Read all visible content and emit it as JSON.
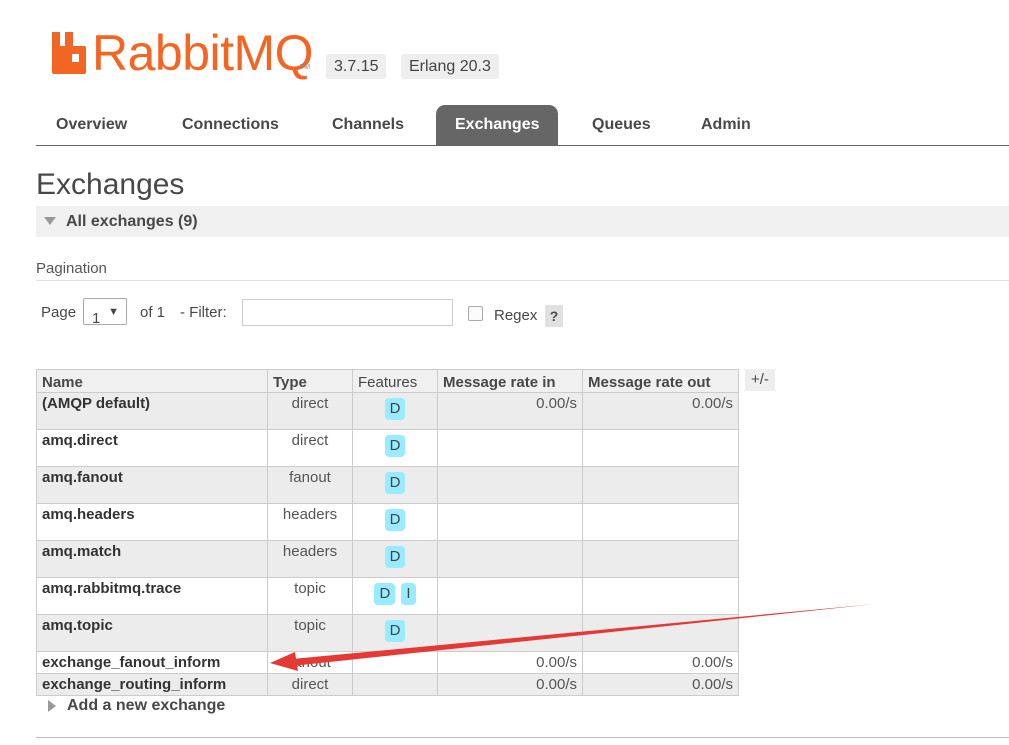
{
  "brand": {
    "logo_text": "RabbitMQ",
    "tm": "TM",
    "version": "3.7.15",
    "erlang": "Erlang 20.3",
    "color": "#f26522"
  },
  "tabs": [
    {
      "label": "Overview"
    },
    {
      "label": "Connections"
    },
    {
      "label": "Channels"
    },
    {
      "label": "Exchanges",
      "active": true
    },
    {
      "label": "Queues"
    },
    {
      "label": "Admin"
    }
  ],
  "page": {
    "title": "Exchanges",
    "section": "All exchanges (9)",
    "add_new": "Add a new exchange"
  },
  "pagination": {
    "heading": "Pagination",
    "page_label": "Page",
    "page_value": "1",
    "of_label": "of 1",
    "filter_label": "- Filter:",
    "filter_value": "",
    "regex_label": "Regex",
    "help": "?"
  },
  "table": {
    "headers": [
      "Name",
      "Type",
      "Features",
      "Message rate in",
      "Message rate out"
    ],
    "toggle_label": "+/-",
    "rows": [
      {
        "name": "(AMQP default)",
        "type": "direct",
        "features": [
          "D"
        ],
        "rate_in": "0.00/s",
        "rate_out": "0.00/s"
      },
      {
        "name": "amq.direct",
        "type": "direct",
        "features": [
          "D"
        ],
        "rate_in": "",
        "rate_out": ""
      },
      {
        "name": "amq.fanout",
        "type": "fanout",
        "features": [
          "D"
        ],
        "rate_in": "",
        "rate_out": ""
      },
      {
        "name": "amq.headers",
        "type": "headers",
        "features": [
          "D"
        ],
        "rate_in": "",
        "rate_out": ""
      },
      {
        "name": "amq.match",
        "type": "headers",
        "features": [
          "D"
        ],
        "rate_in": "",
        "rate_out": ""
      },
      {
        "name": "amq.rabbitmq.trace",
        "type": "topic",
        "features": [
          "D",
          "I"
        ],
        "rate_in": "",
        "rate_out": ""
      },
      {
        "name": "amq.topic",
        "type": "topic",
        "features": [
          "D"
        ],
        "rate_in": "",
        "rate_out": ""
      },
      {
        "name": "exchange_fanout_inform",
        "type": "fanout",
        "features": [],
        "rate_in": "0.00/s",
        "rate_out": "0.00/s"
      },
      {
        "name": "exchange_routing_inform",
        "type": "direct",
        "features": [],
        "rate_in": "0.00/s",
        "rate_out": "0.00/s"
      }
    ]
  },
  "colors": {
    "tab_active_bg": "#666666",
    "feature_badge": "#99ebff",
    "annotation_arrow": "#e53935"
  }
}
